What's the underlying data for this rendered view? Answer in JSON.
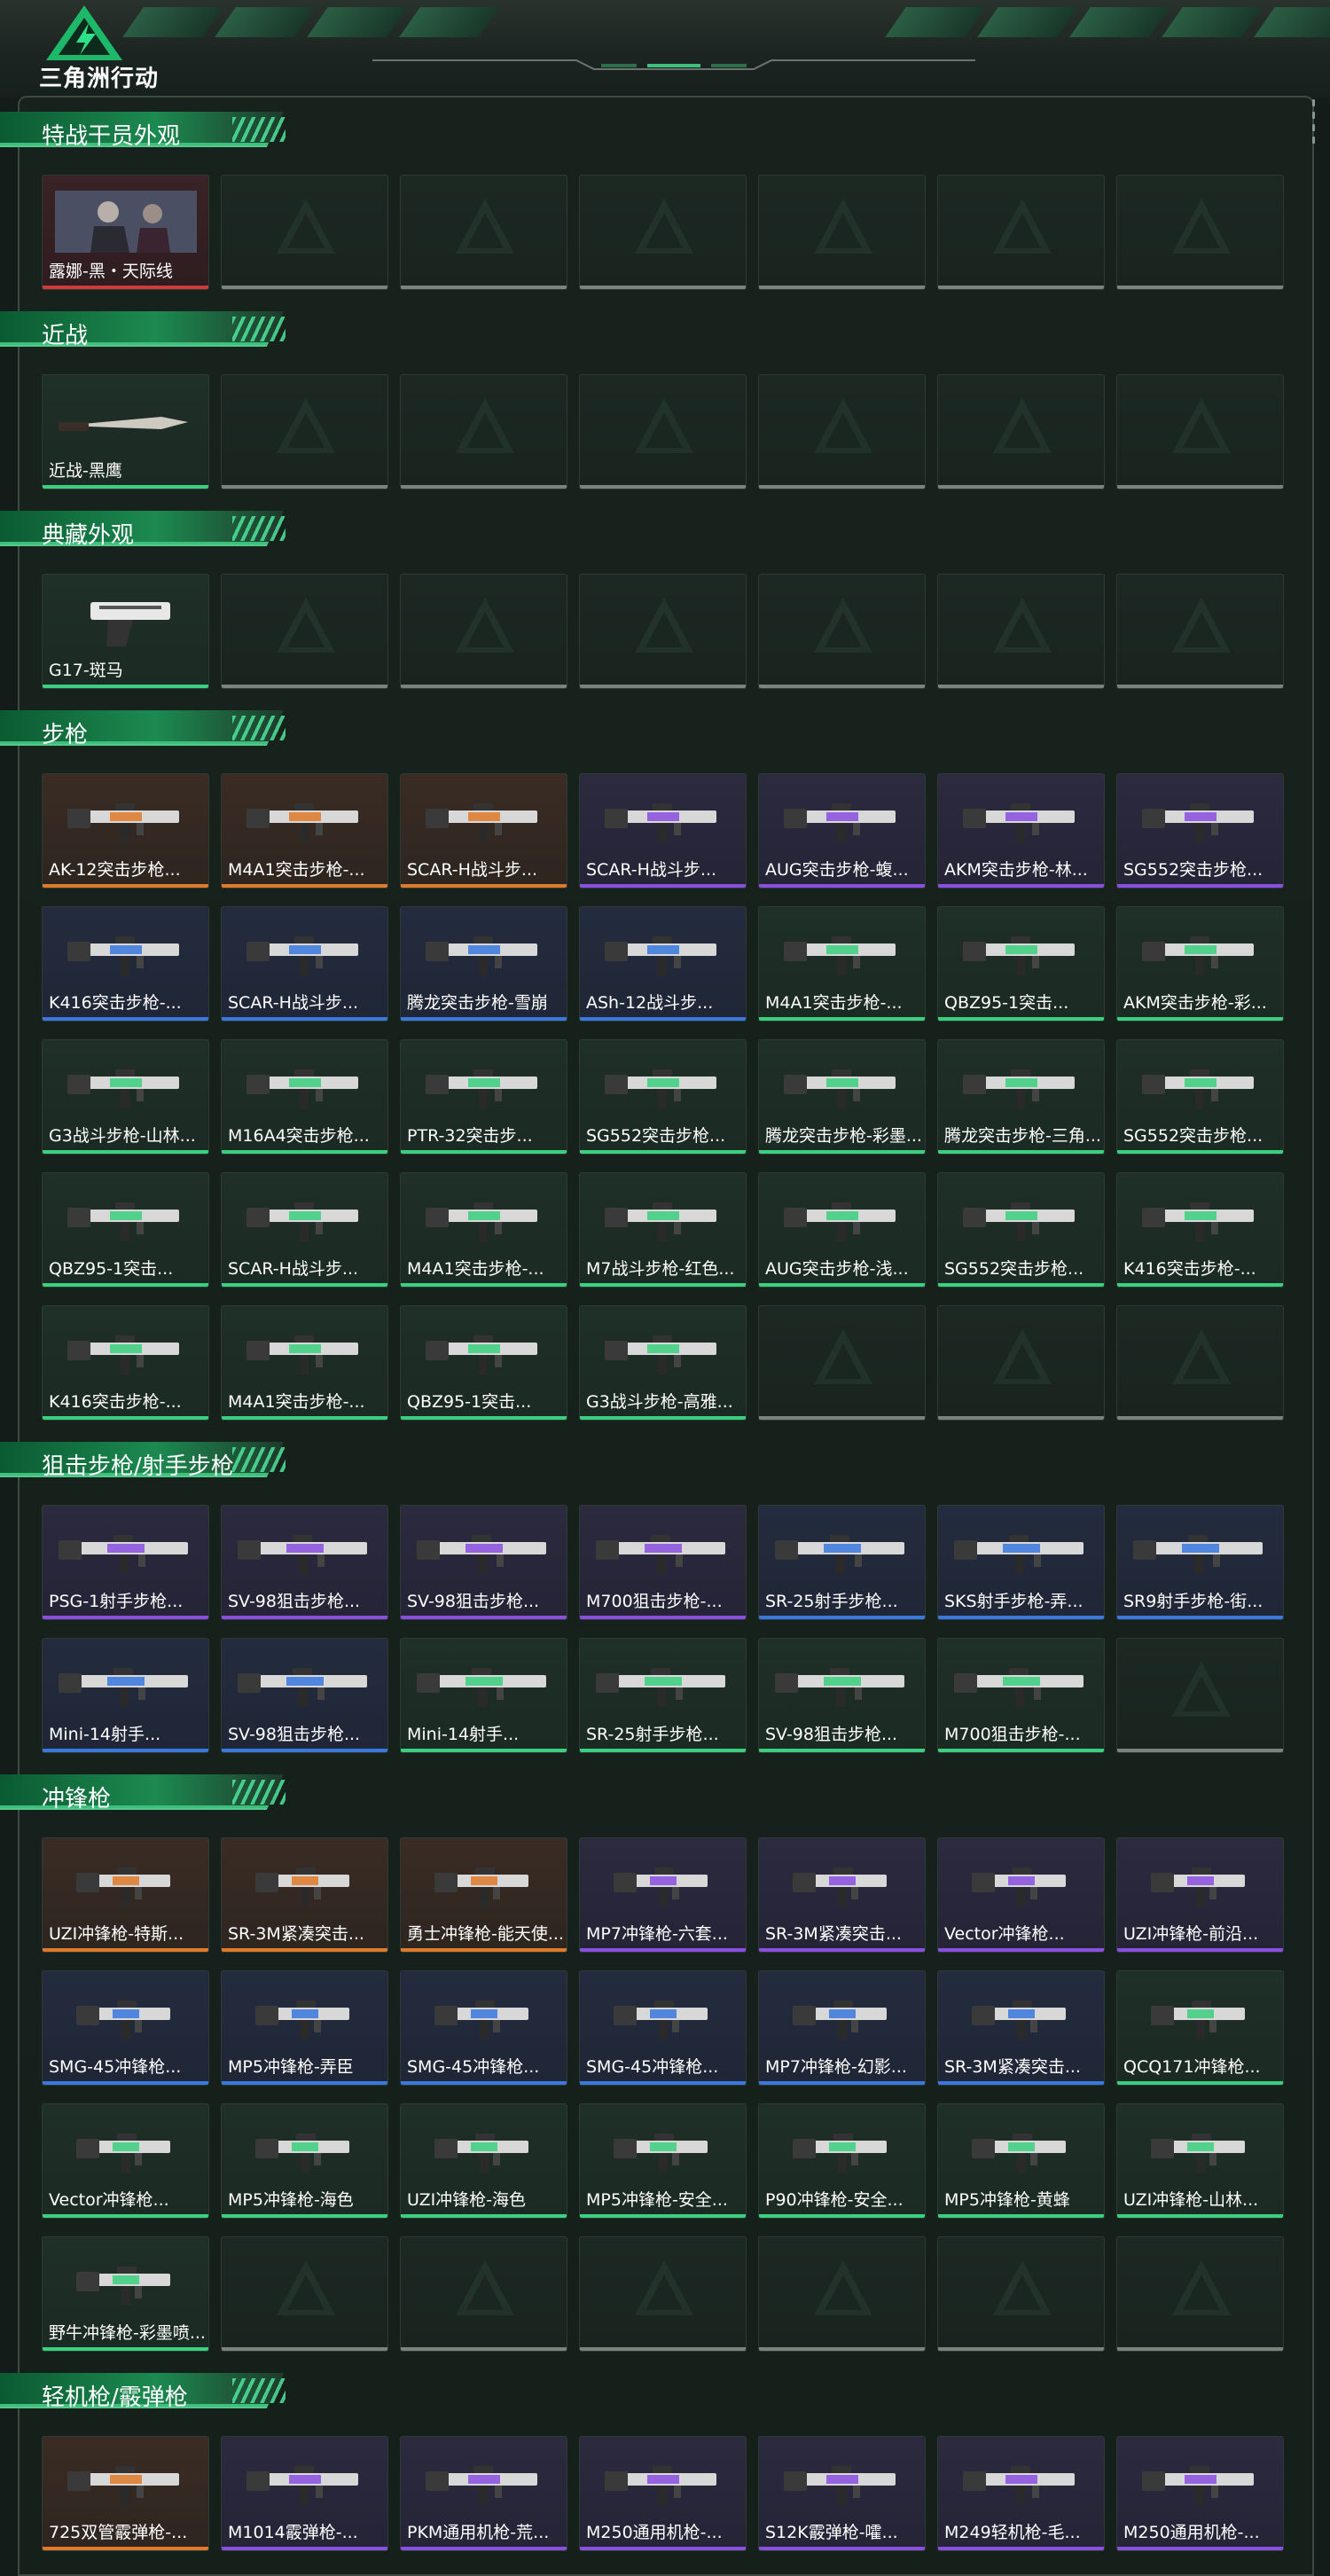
{
  "brand": "三角洲行动",
  "sections": [
    {
      "title": "特战干员外观",
      "items": [
        {
          "label": "露娜-黑・天际线",
          "q": "red",
          "icon": "operator-portrait"
        }
      ]
    },
    {
      "title": "近战",
      "items": [
        {
          "label": "近战-黑鹰",
          "q": "green",
          "icon": "knife-icon"
        }
      ]
    },
    {
      "title": "典藏外观",
      "items": [
        {
          "label": "G17-斑马",
          "q": "green",
          "icon": "pistol-icon"
        }
      ]
    },
    {
      "title": "步枪",
      "items": [
        {
          "label": "AK-12突击步枪...",
          "q": "orange",
          "icon": "rifle-icon"
        },
        {
          "label": "M4A1突击步枪-...",
          "q": "orange",
          "icon": "rifle-icon"
        },
        {
          "label": "SCAR-H战斗步...",
          "q": "orange",
          "icon": "rifle-icon"
        },
        {
          "label": "SCAR-H战斗步...",
          "q": "purple",
          "icon": "rifle-icon"
        },
        {
          "label": "AUG突击步枪-蝮...",
          "q": "purple",
          "icon": "rifle-icon"
        },
        {
          "label": "AKM突击步枪-林...",
          "q": "purple",
          "icon": "rifle-icon"
        },
        {
          "label": "SG552突击步枪...",
          "q": "purple",
          "icon": "rifle-icon"
        },
        {
          "label": "K416突击步枪-...",
          "q": "blue",
          "icon": "rifle-icon"
        },
        {
          "label": "SCAR-H战斗步...",
          "q": "blue",
          "icon": "rifle-icon"
        },
        {
          "label": "腾龙突击步枪-雪崩",
          "q": "blue",
          "icon": "rifle-icon"
        },
        {
          "label": "ASh-12战斗步...",
          "q": "blue",
          "icon": "rifle-icon"
        },
        {
          "label": "M4A1突击步枪-...",
          "q": "green",
          "icon": "rifle-icon"
        },
        {
          "label": "QBZ95-1突击...",
          "q": "green",
          "icon": "rifle-icon"
        },
        {
          "label": "AKM突击步枪-彩...",
          "q": "green",
          "icon": "rifle-icon"
        },
        {
          "label": "G3战斗步枪-山林...",
          "q": "green",
          "icon": "rifle-icon"
        },
        {
          "label": "M16A4突击步枪...",
          "q": "green",
          "icon": "rifle-icon"
        },
        {
          "label": "PTR-32突击步...",
          "q": "green",
          "icon": "rifle-icon"
        },
        {
          "label": "SG552突击步枪...",
          "q": "green",
          "icon": "rifle-icon"
        },
        {
          "label": "腾龙突击步枪-彩墨...",
          "q": "green",
          "icon": "rifle-icon"
        },
        {
          "label": "腾龙突击步枪-三角...",
          "q": "green",
          "icon": "rifle-icon"
        },
        {
          "label": "SG552突击步枪...",
          "q": "green",
          "icon": "rifle-icon"
        },
        {
          "label": "QBZ95-1突击...",
          "q": "green",
          "icon": "rifle-icon"
        },
        {
          "label": "SCAR-H战斗步...",
          "q": "green",
          "icon": "rifle-icon"
        },
        {
          "label": "M4A1突击步枪-...",
          "q": "green",
          "icon": "rifle-icon"
        },
        {
          "label": "M7战斗步枪-红色...",
          "q": "green",
          "icon": "rifle-icon"
        },
        {
          "label": "AUG突击步枪-浅...",
          "q": "green",
          "icon": "rifle-icon"
        },
        {
          "label": "SG552突击步枪...",
          "q": "green",
          "icon": "rifle-icon"
        },
        {
          "label": "K416突击步枪-...",
          "q": "green",
          "icon": "rifle-icon"
        },
        {
          "label": "K416突击步枪-...",
          "q": "green",
          "icon": "rifle-icon"
        },
        {
          "label": "M4A1突击步枪-...",
          "q": "green",
          "icon": "rifle-icon"
        },
        {
          "label": "QBZ95-1突击...",
          "q": "green",
          "icon": "rifle-icon"
        },
        {
          "label": "G3战斗步枪-高雅...",
          "q": "green",
          "icon": "rifle-icon"
        }
      ]
    },
    {
      "title": "狙击步枪/射手步枪",
      "items": [
        {
          "label": "PSG-1射手步枪...",
          "q": "purple",
          "icon": "sniper-icon"
        },
        {
          "label": "SV-98狙击步枪...",
          "q": "purple",
          "icon": "sniper-icon"
        },
        {
          "label": "SV-98狙击步枪...",
          "q": "purple",
          "icon": "sniper-icon"
        },
        {
          "label": "M700狙击步枪-...",
          "q": "purple",
          "icon": "sniper-icon"
        },
        {
          "label": "SR-25射手步枪...",
          "q": "blue",
          "icon": "sniper-icon"
        },
        {
          "label": "SKS射手步枪-弄...",
          "q": "blue",
          "icon": "sniper-icon"
        },
        {
          "label": "SR9射手步枪-街...",
          "q": "blue",
          "icon": "sniper-icon"
        },
        {
          "label": "Mini-14射手...",
          "q": "blue",
          "icon": "sniper-icon"
        },
        {
          "label": "SV-98狙击步枪...",
          "q": "blue",
          "icon": "sniper-icon"
        },
        {
          "label": "Mini-14射手...",
          "q": "green",
          "icon": "sniper-icon"
        },
        {
          "label": "SR-25射手步枪...",
          "q": "green",
          "icon": "sniper-icon"
        },
        {
          "label": "SV-98狙击步枪...",
          "q": "green",
          "icon": "sniper-icon"
        },
        {
          "label": "M700狙击步枪-...",
          "q": "green",
          "icon": "sniper-icon"
        }
      ]
    },
    {
      "title": "冲锋枪",
      "items": [
        {
          "label": "UZI冲锋枪-特斯...",
          "q": "orange",
          "icon": "smg-icon"
        },
        {
          "label": "SR-3M紧凑突击...",
          "q": "orange",
          "icon": "smg-icon"
        },
        {
          "label": "勇士冲锋枪-能天使...",
          "q": "orange",
          "icon": "smg-icon"
        },
        {
          "label": "MP7冲锋枪-六套...",
          "q": "purple",
          "icon": "smg-icon"
        },
        {
          "label": "SR-3M紧凑突击...",
          "q": "purple",
          "icon": "smg-icon"
        },
        {
          "label": "Vector冲锋枪...",
          "q": "purple",
          "icon": "smg-icon"
        },
        {
          "label": "UZI冲锋枪-前沿...",
          "q": "purple",
          "icon": "smg-icon"
        },
        {
          "label": "SMG-45冲锋枪...",
          "q": "blue",
          "icon": "smg-icon"
        },
        {
          "label": "MP5冲锋枪-弄臣",
          "q": "blue",
          "icon": "smg-icon"
        },
        {
          "label": "SMG-45冲锋枪...",
          "q": "blue",
          "icon": "smg-icon"
        },
        {
          "label": "SMG-45冲锋枪...",
          "q": "blue",
          "icon": "smg-icon"
        },
        {
          "label": "MP7冲锋枪-幻影...",
          "q": "blue",
          "icon": "smg-icon"
        },
        {
          "label": "SR-3M紧凑突击...",
          "q": "blue",
          "icon": "smg-icon"
        },
        {
          "label": "QCQ171冲锋枪...",
          "q": "green",
          "icon": "smg-icon"
        },
        {
          "label": "Vector冲锋枪...",
          "q": "green",
          "icon": "smg-icon"
        },
        {
          "label": "MP5冲锋枪-海色",
          "q": "green",
          "icon": "smg-icon"
        },
        {
          "label": "UZI冲锋枪-海色",
          "q": "green",
          "icon": "smg-icon"
        },
        {
          "label": "MP5冲锋枪-安全...",
          "q": "green",
          "icon": "smg-icon"
        },
        {
          "label": "P90冲锋枪-安全...",
          "q": "green",
          "icon": "smg-icon"
        },
        {
          "label": "MP5冲锋枪-黄蜂",
          "q": "green",
          "icon": "smg-icon"
        },
        {
          "label": "UZI冲锋枪-山林...",
          "q": "green",
          "icon": "smg-icon"
        },
        {
          "label": "野牛冲锋枪-彩墨喷...",
          "q": "green",
          "icon": "smg-icon"
        }
      ]
    },
    {
      "title": "轻机枪/霰弹枪",
      "items": [
        {
          "label": "725双管霰弹枪-...",
          "q": "orange",
          "icon": "shotgun-icon"
        },
        {
          "label": "M1014霰弹枪-...",
          "q": "purple",
          "icon": "shotgun-icon"
        },
        {
          "label": "PKM通用机枪-荒...",
          "q": "purple",
          "icon": "lmg-icon"
        },
        {
          "label": "M250通用机枪-...",
          "q": "purple",
          "icon": "lmg-icon"
        },
        {
          "label": "S12K霰弹枪-嚯...",
          "q": "purple",
          "icon": "shotgun-icon"
        },
        {
          "label": "M249轻机枪-毛...",
          "q": "purple",
          "icon": "lmg-icon"
        },
        {
          "label": "M250通用机枪-...",
          "q": "purple",
          "icon": "lmg-icon"
        }
      ]
    }
  ],
  "colors": {
    "accent": "#1c8a50",
    "quality_orange": "#e07a2a",
    "quality_purple": "#8a4fe0",
    "quality_blue": "#3a78e0",
    "quality_green": "#3ad07f",
    "quality_red": "#d23a3a"
  }
}
